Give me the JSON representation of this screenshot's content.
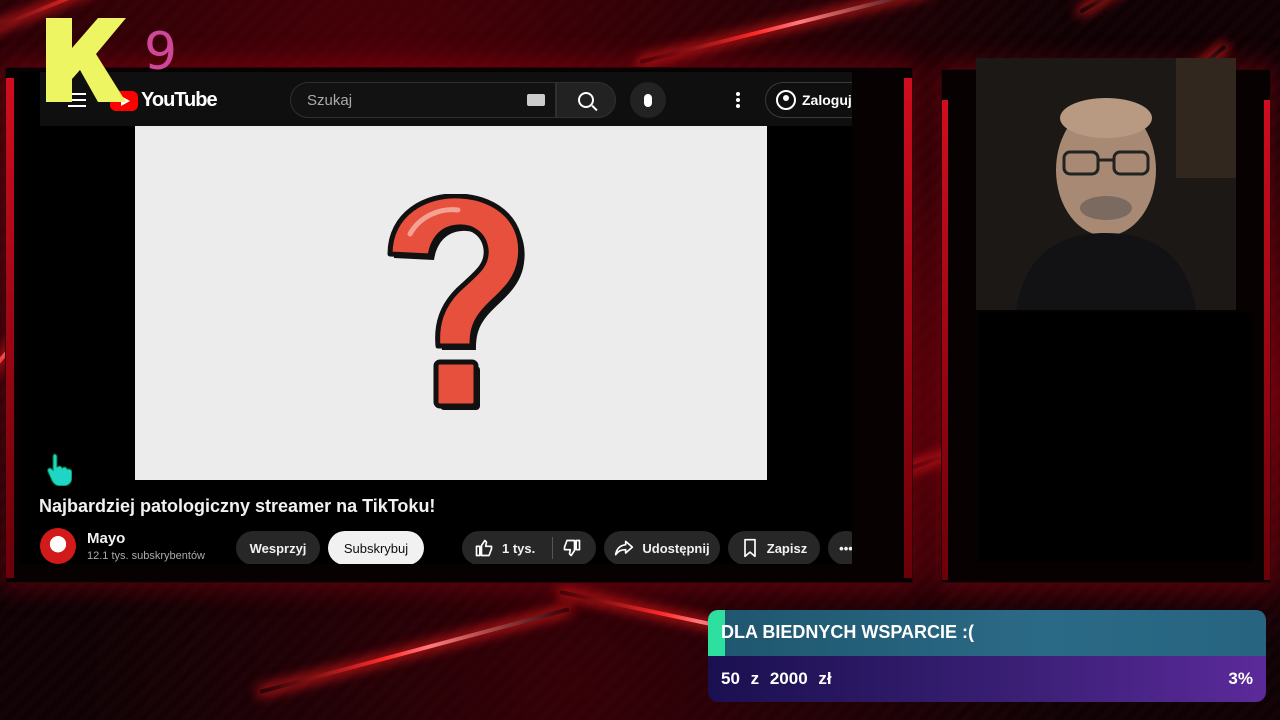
{
  "youtube": {
    "logo_text": "YouTube",
    "search_placeholder": "Szukaj",
    "signin_label": "Zaloguj się",
    "video_title": "Najbardziej patologiczny streamer na TikToku!",
    "channel": {
      "name": "Mayo",
      "subscribers": "12.1 tys. subskrybentów"
    },
    "actions": {
      "support_label": "Wesprzyj",
      "subscribe_label": "Subskrybuj",
      "like_count": "1 tys.",
      "share_label": "Udostępnij",
      "save_label": "Zapisz",
      "more_label": "•••"
    },
    "video_thumbnail_icon": "question-mark-icon"
  },
  "overlay": {
    "logo_letter": "K",
    "logo_number": "9",
    "logo_colors": {
      "k": "#eef562",
      "nine": "#d0469a"
    }
  },
  "donation_goal": {
    "title": "DLA BIEDNYCH WSPARCIE :(",
    "amount_text": "50 z 2000 zł",
    "current": 50,
    "target": 2000,
    "currency": "zł",
    "percent_text": "3%",
    "progress_fraction": 0.03,
    "colors": {
      "fill": "#2ee0a0",
      "header": "#2b6a86",
      "body": "#3a1f75"
    }
  },
  "theme": {
    "accent": "#ff2a2a",
    "youtube_red": "#ff0000"
  }
}
